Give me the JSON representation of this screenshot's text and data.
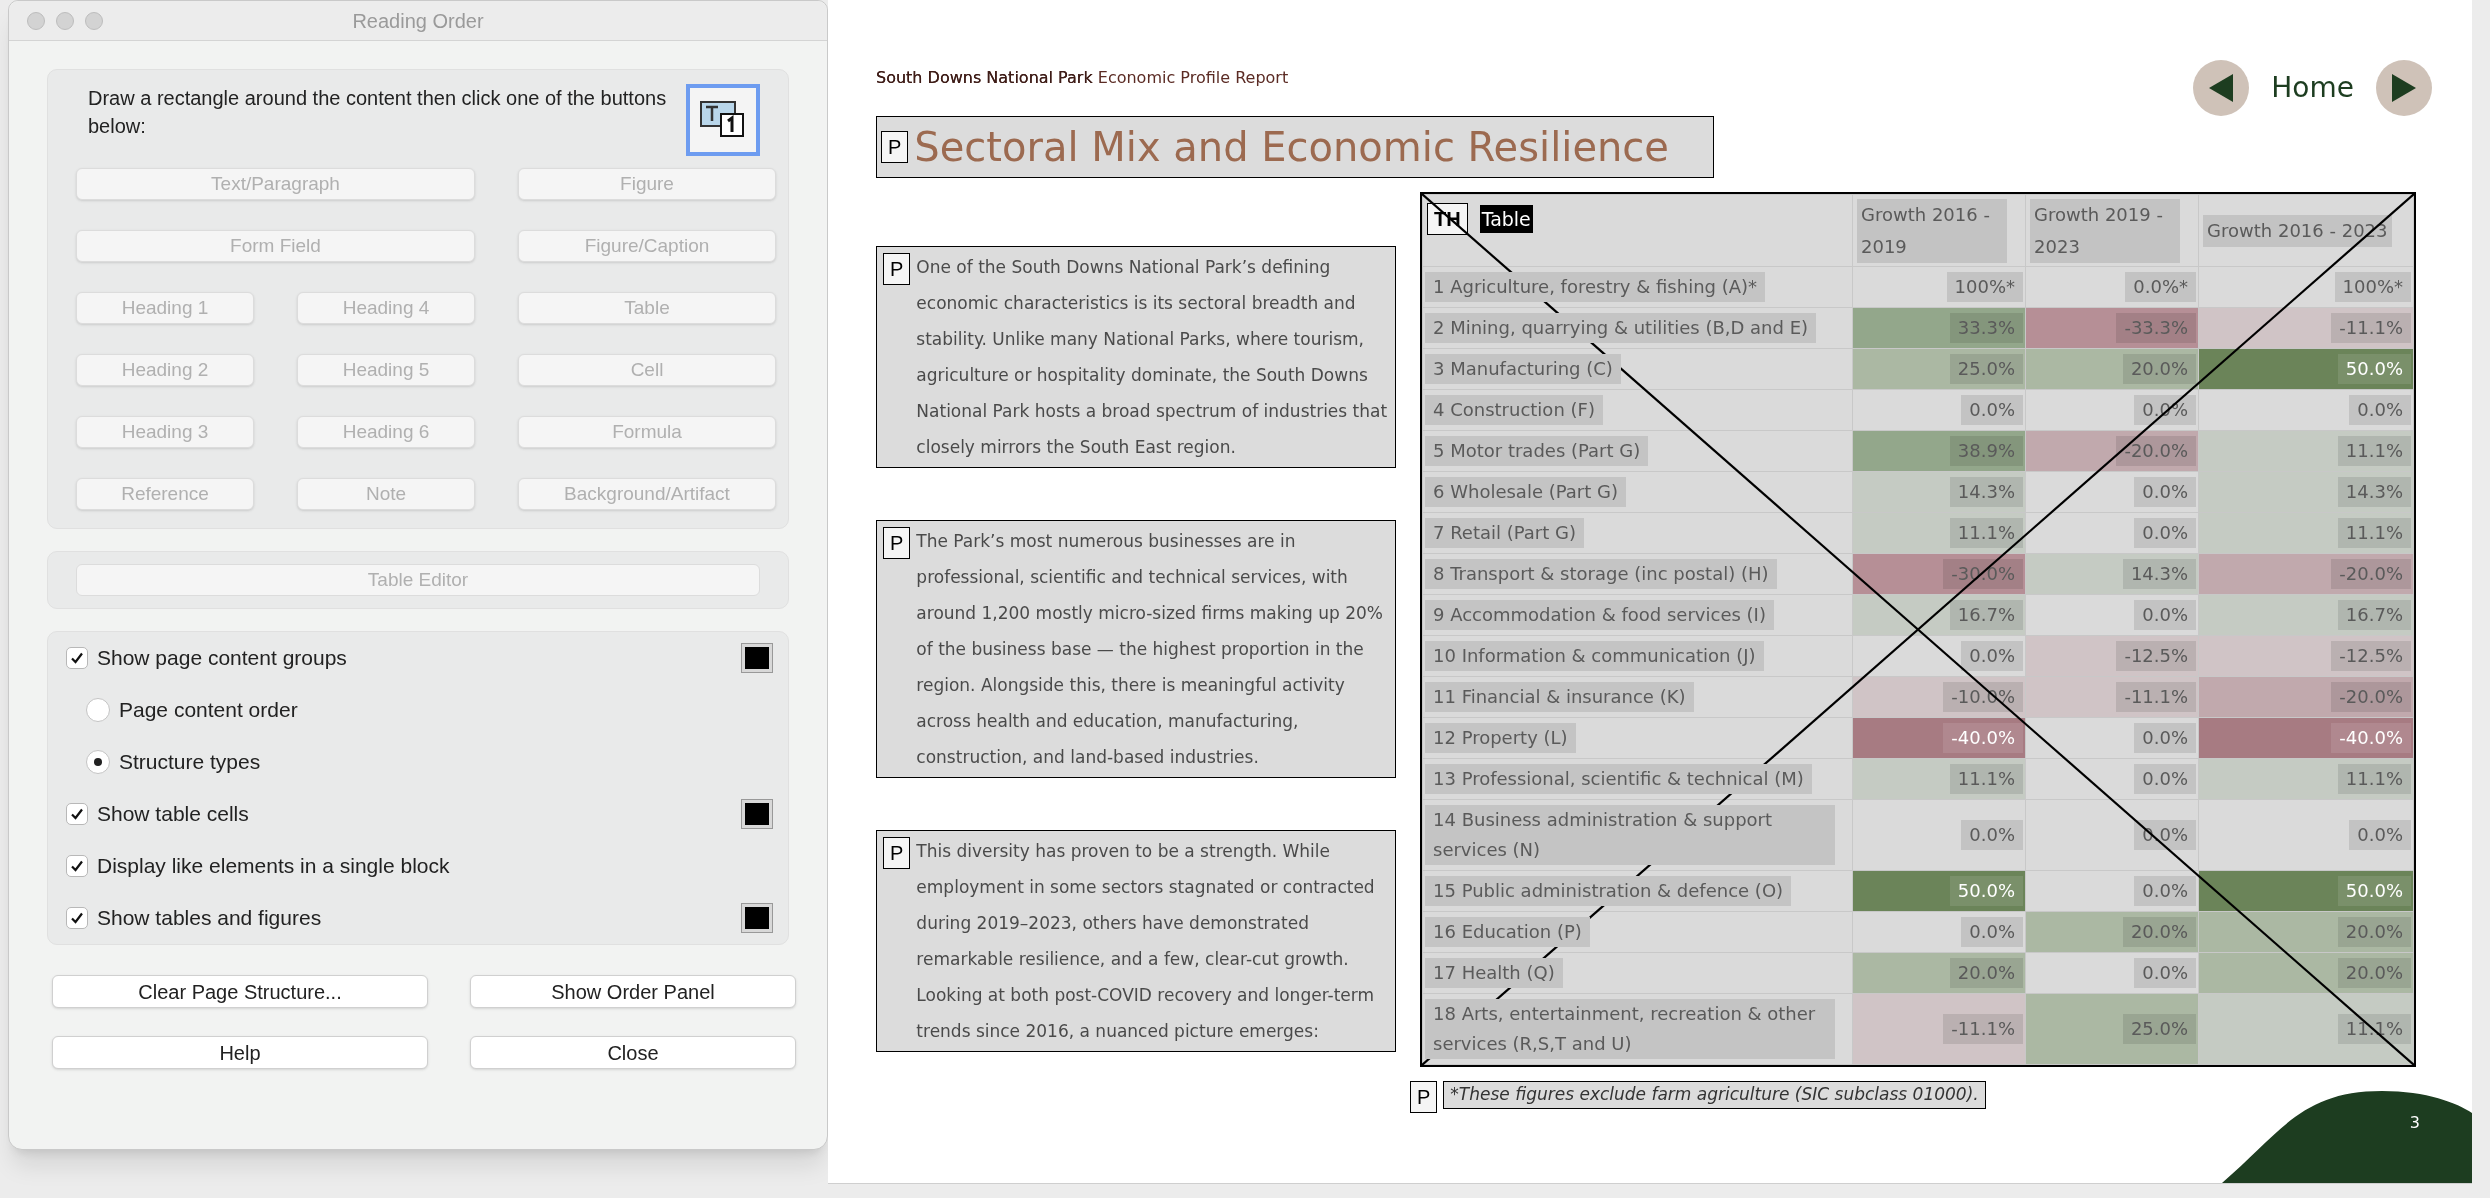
{
  "dialog": {
    "title": "Reading Order",
    "instruction": "Draw a rectangle around the content then click one of the buttons below:",
    "tag_buttons": [
      {
        "label": "Text/Paragraph",
        "wide": true,
        "disabled": true
      },
      {
        "label": "Figure",
        "wide": false,
        "disabled": true
      },
      {
        "label": "Form Field",
        "wide": true,
        "disabled": true
      },
      {
        "label": "Figure/Caption",
        "wide": false,
        "disabled": true
      },
      {
        "label": "Heading 1",
        "wide": false,
        "disabled": true
      },
      {
        "label": "Heading 4",
        "wide": false,
        "disabled": true
      },
      {
        "label": "Table",
        "wide": false,
        "disabled": true
      },
      {
        "label": "Heading 2",
        "wide": false,
        "disabled": true
      },
      {
        "label": "Heading 5",
        "wide": false,
        "disabled": true
      },
      {
        "label": "Cell",
        "wide": false,
        "disabled": true
      },
      {
        "label": "Heading 3",
        "wide": false,
        "disabled": true
      },
      {
        "label": "Heading 6",
        "wide": false,
        "disabled": true
      },
      {
        "label": "Formula",
        "wide": false,
        "disabled": true
      },
      {
        "label": "Reference",
        "wide": false,
        "disabled": true
      },
      {
        "label": "Note",
        "wide": false,
        "disabled": true
      },
      {
        "label": "Background/Artifact",
        "wide": false,
        "disabled": true
      }
    ],
    "table_editor": {
      "label": "Table Editor",
      "disabled": true
    },
    "options": [
      {
        "kind": "checkbox",
        "label": "Show page content groups",
        "checked": true,
        "color": "#000000"
      },
      {
        "kind": "radio",
        "label": "Page content order",
        "selected": false
      },
      {
        "kind": "radio",
        "label": "Structure types",
        "selected": true
      },
      {
        "kind": "checkbox",
        "label": "Show table cells",
        "checked": true,
        "color": "#000000"
      },
      {
        "kind": "checkbox",
        "label": "Display like elements in a single block",
        "checked": true
      },
      {
        "kind": "checkbox",
        "label": "Show tables and figures",
        "checked": true,
        "color": "#000000"
      }
    ],
    "buttons": [
      "Clear Page Structure...",
      "Show Order Panel",
      "Help",
      "Close"
    ]
  },
  "document": {
    "header_bold": "South Downs National Park",
    "header_rest": "Economic Profile Report",
    "nav_label": "Home",
    "title": {
      "tag": "P",
      "text": "Sectoral Mix and Economic Resilience"
    },
    "paragraphs": [
      {
        "tag": "P",
        "text": "One of the South Downs National Park’s defining economic characteristics is its sectoral breadth and stability. Unlike many National Parks, where tourism, agriculture or hospitality dominate, the South Downs National Park hosts a broad spectrum of industries that closely mirrors the South East region."
      },
      {
        "tag": "P",
        "text": "The Park’s most numerous businesses are in professional, scientific and technical services, with around 1,200 mostly micro-sized firms making up 20% of the business base — the highest proportion in the region. Alongside this, there is meaningful activity across health and education, manufacturing, construction, and land-based industries."
      },
      {
        "tag": "P",
        "text": "This diversity has proven to be a strength. While employment in some sectors stagnated or contracted during 2019–2023, others have demonstrated remarkable resilience, and a few, clear-cut growth. Looking at both post-COVID recovery and longer-term trends since 2016, a nuanced picture emerges:"
      }
    ],
    "table": {
      "tag": "TH",
      "type_label": "Table",
      "columns": [
        "Growth 2016 - 2019",
        "Growth 2019 - 2023",
        "Growth 2016 - 2023"
      ],
      "rows": [
        {
          "label": "1 Agriculture, forestry & fishing (A)*",
          "cells": [
            {
              "text": "100%*",
              "color": "#dadada"
            },
            {
              "text": "0.0%*",
              "color": "#dadada"
            },
            {
              "text": "100%*",
              "color": "#dadada"
            }
          ]
        },
        {
          "label": "2 Mining, quarrying & utilities (B,D and E)",
          "cells": [
            {
              "text": "33.3%",
              "color": "#93a78b"
            },
            {
              "text": "-33.3%",
              "color": "#b68f96"
            },
            {
              "text": "-11.1%",
              "color": "#d0c4c6"
            }
          ]
        },
        {
          "label": "3 Manufacturing (C)",
          "cells": [
            {
              "text": "25.0%",
              "color": "#abb8a3"
            },
            {
              "text": "20.0%",
              "color": "#abb8a3"
            },
            {
              "text": "50.0%",
              "color": "#6b8459"
            }
          ]
        },
        {
          "label": "4 Construction (F)",
          "cells": [
            {
              "text": "0.0%",
              "color": "#dadada"
            },
            {
              "text": "0.0%",
              "color": "#dadada"
            },
            {
              "text": "0.0%",
              "color": "#dadada"
            }
          ]
        },
        {
          "label": "5 Motor trades (Part G)",
          "cells": [
            {
              "text": "38.9%",
              "color": "#93a78b"
            },
            {
              "text": "-20.0%",
              "color": "#c1a9ad"
            },
            {
              "text": "11.1%",
              "color": "#c5cbc3"
            }
          ]
        },
        {
          "label": "6 Wholesale (Part G)",
          "cells": [
            {
              "text": "14.3%",
              "color": "#c5cbc3"
            },
            {
              "text": "0.0%",
              "color": "#dadada"
            },
            {
              "text": "14.3%",
              "color": "#c5cbc3"
            }
          ]
        },
        {
          "label": "7 Retail (Part G)",
          "cells": [
            {
              "text": "11.1%",
              "color": "#c5cbc3"
            },
            {
              "text": "0.0%",
              "color": "#dadada"
            },
            {
              "text": "11.1%",
              "color": "#c5cbc3"
            }
          ]
        },
        {
          "label": "8 Transport & storage (inc postal) (H)",
          "cells": [
            {
              "text": "-30.0%",
              "color": "#b68f96"
            },
            {
              "text": "14.3%",
              "color": "#c5cbc3"
            },
            {
              "text": "-20.0%",
              "color": "#c1a9ad"
            }
          ]
        },
        {
          "label": "9 Accommodation & food services (I)",
          "cells": [
            {
              "text": "16.7%",
              "color": "#c5cbc3"
            },
            {
              "text": "0.0%",
              "color": "#dadada"
            },
            {
              "text": "16.7%",
              "color": "#c5cbc3"
            }
          ]
        },
        {
          "label": "10 Information & communication (J)",
          "cells": [
            {
              "text": "0.0%",
              "color": "#dadada"
            },
            {
              "text": "-12.5%",
              "color": "#d0c4c6"
            },
            {
              "text": "-12.5%",
              "color": "#d0c4c6"
            }
          ]
        },
        {
          "label": "11 Financial & insurance (K)",
          "cells": [
            {
              "text": "-10.0%",
              "color": "#d0c4c6"
            },
            {
              "text": "-11.1%",
              "color": "#d0c4c6"
            },
            {
              "text": "-20.0%",
              "color": "#c1a9ad"
            }
          ]
        },
        {
          "label": "12 Property (L)",
          "cells": [
            {
              "text": "-40.0%",
              "color": "#a77b82"
            },
            {
              "text": "0.0%",
              "color": "#dadada"
            },
            {
              "text": "-40.0%",
              "color": "#a77b82"
            }
          ]
        },
        {
          "label": "13 Professional, scientific & technical (M)",
          "cells": [
            {
              "text": "11.1%",
              "color": "#c5cbc3"
            },
            {
              "text": "0.0%",
              "color": "#dadada"
            },
            {
              "text": "11.1%",
              "color": "#c5cbc3"
            }
          ]
        },
        {
          "label": "14 Business administration & support services (N)",
          "cells": [
            {
              "text": "0.0%",
              "color": "#dadada"
            },
            {
              "text": "0.0%",
              "color": "#dadada"
            },
            {
              "text": "0.0%",
              "color": "#dadada"
            }
          ]
        },
        {
          "label": "15 Public administration & defence (O)",
          "cells": [
            {
              "text": "50.0%",
              "color": "#6b8459"
            },
            {
              "text": "0.0%",
              "color": "#dadada"
            },
            {
              "text": "50.0%",
              "color": "#6b8459"
            }
          ]
        },
        {
          "label": "16 Education (P)",
          "cells": [
            {
              "text": "0.0%",
              "color": "#dadada"
            },
            {
              "text": "20.0%",
              "color": "#abb8a3"
            },
            {
              "text": "20.0%",
              "color": "#abb8a3"
            }
          ]
        },
        {
          "label": "17 Health (Q)",
          "cells": [
            {
              "text": "20.0%",
              "color": "#abb8a3"
            },
            {
              "text": "0.0%",
              "color": "#dadada"
            },
            {
              "text": "20.0%",
              "color": "#abb8a3"
            }
          ]
        },
        {
          "label": "18 Arts, entertainment, recreation & other services (R,S,T and U)",
          "cells": [
            {
              "text": "-11.1%",
              "color": "#d0c4c6"
            },
            {
              "text": "25.0%",
              "color": "#abb8a3"
            },
            {
              "text": "11.1%",
              "color": "#c5cbc3"
            }
          ]
        }
      ]
    },
    "footnote": {
      "tag": "P",
      "text": "*These figures exclude farm agriculture (SIC subclass 01000)."
    },
    "page_number": "3"
  }
}
